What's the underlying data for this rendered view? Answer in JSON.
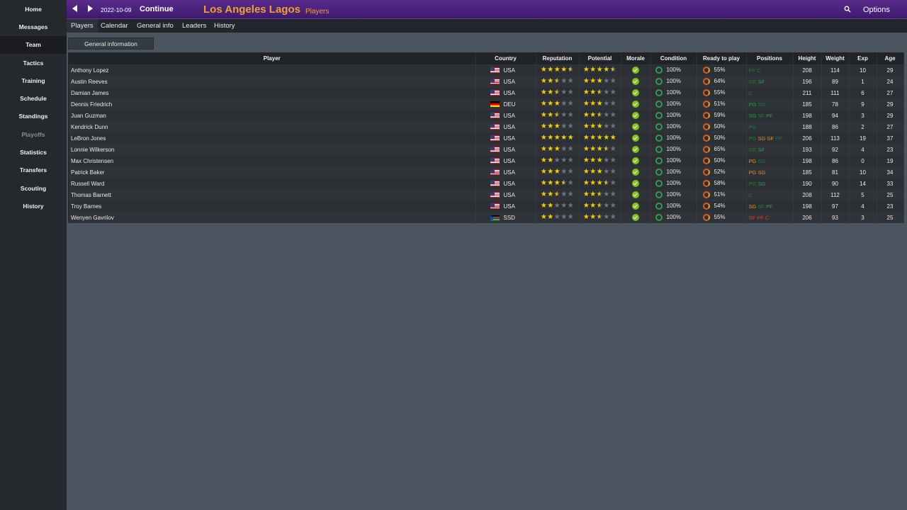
{
  "sidebar": {
    "items": [
      {
        "label": "Home",
        "state": "normal"
      },
      {
        "label": "Messages",
        "state": "normal"
      },
      {
        "label": "Team",
        "state": "active"
      },
      {
        "label": "Tactics",
        "state": "normal"
      },
      {
        "label": "Training",
        "state": "normal"
      },
      {
        "label": "Schedule",
        "state": "normal"
      },
      {
        "label": "Standings",
        "state": "normal"
      },
      {
        "label": "Playoffs",
        "state": "disabled"
      },
      {
        "label": "Statistics",
        "state": "normal"
      },
      {
        "label": "Transfers",
        "state": "normal"
      },
      {
        "label": "Scouting",
        "state": "normal"
      },
      {
        "label": "History",
        "state": "normal"
      }
    ]
  },
  "header": {
    "date": "2022-10-09",
    "continue_label": "Continue",
    "team_name": "Los Angeles Lagos",
    "subtitle": "Players",
    "options_label": "Options",
    "icons": [
      "back-arrow-icon",
      "forward-arrow-icon",
      "search-icon"
    ]
  },
  "tabs": [
    {
      "label": "Players",
      "active": true
    },
    {
      "label": "Calendar",
      "active": false
    },
    {
      "label": "General info",
      "active": false
    },
    {
      "label": "Leaders",
      "active": false
    },
    {
      "label": "History",
      "active": false
    }
  ],
  "view_button": "General information",
  "table": {
    "columns": [
      "Player",
      "Country",
      "Reputation",
      "Potential",
      "Morale",
      "Condition",
      "Ready to play",
      "Positions",
      "Height",
      "Weight",
      "Exp",
      "Age"
    ],
    "rows": [
      {
        "name": "Anthony Lopez",
        "country": "USA",
        "rep": 4.5,
        "pot": 4.5,
        "condition": "100%",
        "ready": "55%",
        "positions": [
          [
            "PF",
            "d"
          ],
          [
            "C",
            "d"
          ]
        ],
        "height": "208",
        "weight": "114",
        "exp": "10",
        "age": "29"
      },
      {
        "name": "Austin Reeves",
        "country": "USA",
        "rep": 2.5,
        "pot": 3,
        "condition": "100%",
        "ready": "64%",
        "positions": [
          [
            "SG",
            "d"
          ],
          [
            "SF",
            "g"
          ]
        ],
        "height": "196",
        "weight": "89",
        "exp": "1",
        "age": "24"
      },
      {
        "name": "Damian James",
        "country": "USA",
        "rep": 2.5,
        "pot": 2.5,
        "condition": "100%",
        "ready": "55%",
        "positions": [
          [
            "C",
            "d"
          ]
        ],
        "height": "211",
        "weight": "111",
        "exp": "6",
        "age": "27"
      },
      {
        "name": "Dennis Friedrich",
        "country": "DEU",
        "rep": 3,
        "pot": 3,
        "condition": "100%",
        "ready": "51%",
        "positions": [
          [
            "PG",
            "g"
          ],
          [
            "SG",
            "d"
          ]
        ],
        "height": "185",
        "weight": "78",
        "exp": "9",
        "age": "29"
      },
      {
        "name": "Juan Guzman",
        "country": "USA",
        "rep": 2.5,
        "pot": 2.5,
        "condition": "100%",
        "ready": "59%",
        "positions": [
          [
            "SG",
            "g"
          ],
          [
            "SF",
            "d"
          ],
          [
            "PF",
            "g"
          ]
        ],
        "height": "198",
        "weight": "94",
        "exp": "3",
        "age": "29"
      },
      {
        "name": "Kendrick Dunn",
        "country": "USA",
        "rep": 3,
        "pot": 3,
        "condition": "100%",
        "ready": "50%",
        "positions": [
          [
            "PG",
            "d"
          ]
        ],
        "height": "188",
        "weight": "86",
        "exp": "2",
        "age": "27"
      },
      {
        "name": "LeBron Jones",
        "country": "USA",
        "rep": 5,
        "pot": 5,
        "condition": "100%",
        "ready": "50%",
        "positions": [
          [
            "PG",
            "d"
          ],
          [
            "SG",
            "o"
          ],
          [
            "SF",
            "o"
          ],
          [
            "PF",
            "d"
          ]
        ],
        "height": "206",
        "weight": "113",
        "exp": "19",
        "age": "37"
      },
      {
        "name": "Lonnie Wilkerson",
        "country": "USA",
        "rep": 3,
        "pot": 3.5,
        "condition": "100%",
        "ready": "65%",
        "positions": [
          [
            "SG",
            "d"
          ],
          [
            "SF",
            "g"
          ]
        ],
        "height": "193",
        "weight": "92",
        "exp": "4",
        "age": "23"
      },
      {
        "name": "Max Christensen",
        "country": "USA",
        "rep": 2,
        "pot": 3,
        "condition": "100%",
        "ready": "50%",
        "positions": [
          [
            "PG",
            "o"
          ],
          [
            "SG",
            "d"
          ]
        ],
        "height": "198",
        "weight": "86",
        "exp": "0",
        "age": "19"
      },
      {
        "name": "Patrick Baker",
        "country": "USA",
        "rep": 3,
        "pot": 3,
        "condition": "100%",
        "ready": "52%",
        "positions": [
          [
            "PG",
            "o"
          ],
          [
            "SG",
            "o"
          ]
        ],
        "height": "185",
        "weight": "81",
        "exp": "10",
        "age": "34"
      },
      {
        "name": "Russell Ward",
        "country": "USA",
        "rep": 3.5,
        "pot": 3.5,
        "condition": "100%",
        "ready": "58%",
        "positions": [
          [
            "PG",
            "d"
          ],
          [
            "SG",
            "g"
          ]
        ],
        "height": "190",
        "weight": "90",
        "exp": "14",
        "age": "33"
      },
      {
        "name": "Thomas Barnett",
        "country": "USA",
        "rep": 2.5,
        "pot": 2.5,
        "condition": "100%",
        "ready": "51%",
        "positions": [
          [
            "C",
            "d"
          ]
        ],
        "height": "208",
        "weight": "112",
        "exp": "5",
        "age": "25"
      },
      {
        "name": "Troy Barnes",
        "country": "USA",
        "rep": 2,
        "pot": 2.5,
        "condition": "100%",
        "ready": "54%",
        "positions": [
          [
            "SG",
            "o"
          ],
          [
            "SF",
            "d"
          ],
          [
            "PF",
            "g"
          ]
        ],
        "height": "198",
        "weight": "97",
        "exp": "4",
        "age": "23"
      },
      {
        "name": "Wenyen Gavrilov",
        "country": "SSD",
        "rep": 2,
        "pot": 2.5,
        "condition": "100%",
        "ready": "55%",
        "positions": [
          [
            "SF",
            "r"
          ],
          [
            "PF",
            "r"
          ],
          [
            "C",
            "r"
          ]
        ],
        "height": "206",
        "weight": "93",
        "exp": "3",
        "age": "25"
      }
    ]
  },
  "colors": {
    "accent": "#5a2b8a",
    "team_name": "#f0a030",
    "star": "#f5d000",
    "morale_ok": "#7ec21c"
  }
}
